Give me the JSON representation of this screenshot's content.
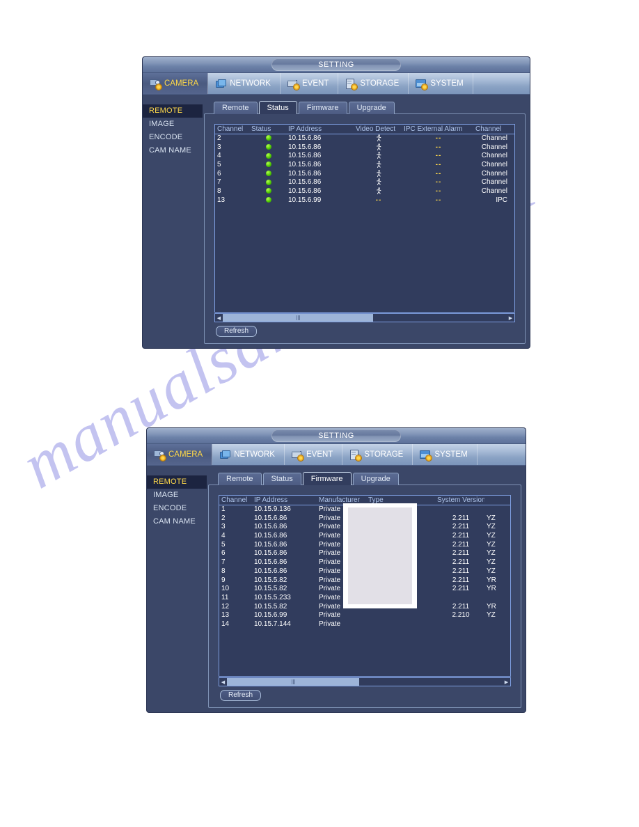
{
  "watermark": {
    "text": "manualsarchive.com"
  },
  "window": {
    "title": "SETTING",
    "menu": [
      {
        "label": "CAMERA",
        "icon": "camera-icon",
        "active": true
      },
      {
        "label": "NETWORK",
        "icon": "network-icon",
        "active": false
      },
      {
        "label": "EVENT",
        "icon": "event-icon",
        "active": false
      },
      {
        "label": "STORAGE",
        "icon": "storage-icon",
        "active": false
      },
      {
        "label": "SYSTEM",
        "icon": "system-icon",
        "active": false
      }
    ],
    "sidebar": [
      {
        "label": "REMOTE",
        "active": true
      },
      {
        "label": "IMAGE",
        "active": false
      },
      {
        "label": "ENCODE",
        "active": false
      },
      {
        "label": "CAM NAME",
        "active": false
      }
    ],
    "tabs": [
      "Remote",
      "Status",
      "Firmware",
      "Upgrade"
    ],
    "refresh_label": "Refresh",
    "scroll_left_glyph": "◀",
    "scroll_right_glyph": "▶"
  },
  "colors": {
    "accent_yellow": "#ffd94a",
    "panel_bg": "#3b4768",
    "table_bg": "#313c5d",
    "table_border": "#7e9ee0",
    "status_green": "#49c400",
    "header_text": "#aec4ea"
  },
  "panel1": {
    "active_tab": "Status",
    "table": {
      "headers": [
        "Channel",
        "Status",
        "IP Address",
        "Video Detect",
        "IPC External Alarm",
        "Channel"
      ],
      "rows": [
        {
          "channel": "2",
          "status": "online",
          "ip": "10.15.6.86",
          "video_detect": "motion",
          "ipc_alarm": "--",
          "channel_name": "Channel"
        },
        {
          "channel": "3",
          "status": "online",
          "ip": "10.15.6.86",
          "video_detect": "motion",
          "ipc_alarm": "--",
          "channel_name": "Channel"
        },
        {
          "channel": "4",
          "status": "online",
          "ip": "10.15.6.86",
          "video_detect": "motion",
          "ipc_alarm": "--",
          "channel_name": "Channel"
        },
        {
          "channel": "5",
          "status": "online",
          "ip": "10.15.6.86",
          "video_detect": "motion",
          "ipc_alarm": "--",
          "channel_name": "Channel"
        },
        {
          "channel": "6",
          "status": "online",
          "ip": "10.15.6.86",
          "video_detect": "motion",
          "ipc_alarm": "--",
          "channel_name": "Channel"
        },
        {
          "channel": "7",
          "status": "online",
          "ip": "10.15.6.86",
          "video_detect": "motion",
          "ipc_alarm": "--",
          "channel_name": "Channel"
        },
        {
          "channel": "8",
          "status": "online",
          "ip": "10.15.6.86",
          "video_detect": "motion",
          "ipc_alarm": "--",
          "channel_name": "Channel"
        },
        {
          "channel": "13",
          "status": "online",
          "ip": "10.15.6.99",
          "video_detect": "--",
          "ipc_alarm": "--",
          "channel_name": "IPC"
        }
      ]
    },
    "scrollbar": {
      "thumb_start_pct": 0,
      "thumb_width_pct": 53
    }
  },
  "panel2": {
    "active_tab": "Firmware",
    "table": {
      "headers": [
        "Channel",
        "IP Address",
        "Manufacturer",
        "Type",
        "System Version",
        ""
      ],
      "rows": [
        {
          "channel": "1",
          "ip": "10.15.9.136",
          "manufacturer": "Private",
          "type": "",
          "version": "",
          "extra": ""
        },
        {
          "channel": "2",
          "ip": "10.15.6.86",
          "manufacturer": "Private",
          "type": "",
          "version": "2.211",
          "extra": "YZ"
        },
        {
          "channel": "3",
          "ip": "10.15.6.86",
          "manufacturer": "Private",
          "type": "",
          "version": "2.211",
          "extra": "YZ"
        },
        {
          "channel": "4",
          "ip": "10.15.6.86",
          "manufacturer": "Private",
          "type": "",
          "version": "2.211",
          "extra": "YZ"
        },
        {
          "channel": "5",
          "ip": "10.15.6.86",
          "manufacturer": "Private",
          "type": "",
          "version": "2.211",
          "extra": "YZ"
        },
        {
          "channel": "6",
          "ip": "10.15.6.86",
          "manufacturer": "Private",
          "type": "",
          "version": "2.211",
          "extra": "YZ"
        },
        {
          "channel": "7",
          "ip": "10.15.6.86",
          "manufacturer": "Private",
          "type": "",
          "version": "2.211",
          "extra": "YZ"
        },
        {
          "channel": "8",
          "ip": "10.15.6.86",
          "manufacturer": "Private",
          "type": "",
          "version": "2.211",
          "extra": "YZ"
        },
        {
          "channel": "9",
          "ip": "10.15.5.82",
          "manufacturer": "Private",
          "type": "",
          "version": "2.211",
          "extra": "YR"
        },
        {
          "channel": "10",
          "ip": "10.15.5.82",
          "manufacturer": "Private",
          "type": "",
          "version": "2.211",
          "extra": "YR"
        },
        {
          "channel": "11",
          "ip": "10.15.5.233",
          "manufacturer": "Private",
          "type": "",
          "version": "",
          "extra": ""
        },
        {
          "channel": "12",
          "ip": "10.15.5.82",
          "manufacturer": "Private",
          "type": "",
          "version": "2.211",
          "extra": "YR"
        },
        {
          "channel": "13",
          "ip": "10.15.6.99",
          "manufacturer": "Private",
          "type": "",
          "version": "2.210",
          "extra": "YZ"
        },
        {
          "channel": "14",
          "ip": "10.15.7.144",
          "manufacturer": "Private",
          "type": "",
          "version": "",
          "extra": ""
        }
      ]
    },
    "scrollbar": {
      "thumb_start_pct": 0,
      "thumb_width_pct": 48
    }
  }
}
